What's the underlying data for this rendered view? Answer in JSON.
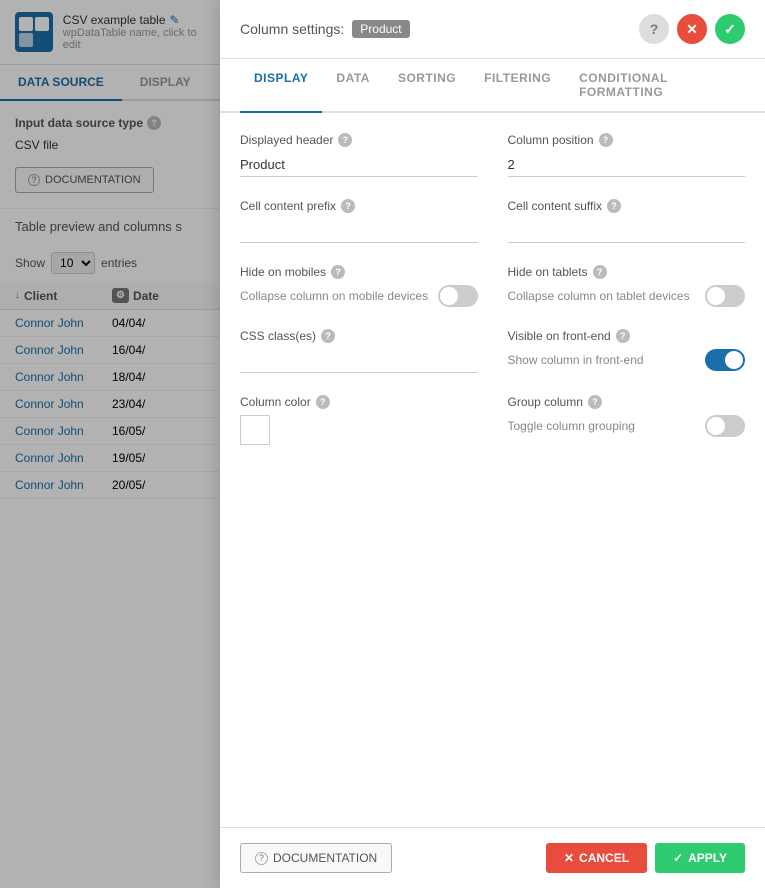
{
  "app": {
    "title": "CSV example table",
    "subtitle": "wpDataTable name, click to edit",
    "logo_alt": "wpDataTables logo"
  },
  "left_tabs": {
    "data_source": "DATA SOURCE",
    "display": "DISPLAY",
    "active": "DATA SOURCE"
  },
  "datasource": {
    "section_label": "Input data source type",
    "value": "CSV file",
    "doc_button": "DOCUMENTATION"
  },
  "table_preview": {
    "label": "Table preview and columns s",
    "show_label": "Show",
    "entries_value": "10",
    "entries_label": "entries",
    "columns": [
      {
        "name": "Client",
        "sortable": true
      },
      {
        "name": "Date",
        "sortable": false
      }
    ],
    "rows": [
      {
        "client": "Connor John",
        "date": "04/04/"
      },
      {
        "client": "Connor John",
        "date": "16/04/"
      },
      {
        "client": "Connor John",
        "date": "18/04/"
      },
      {
        "client": "Connor John",
        "date": "23/04/"
      },
      {
        "client": "Connor John",
        "date": "16/05/"
      },
      {
        "client": "Connor John",
        "date": "19/05/"
      },
      {
        "client": "Connor John",
        "date": "20/05/"
      }
    ]
  },
  "modal": {
    "title_prefix": "Column settings:",
    "column_name": "Product",
    "help_title": "Help",
    "close_title": "Close",
    "confirm_title": "Apply",
    "tabs": [
      {
        "id": "display",
        "label": "DISPLAY",
        "active": true
      },
      {
        "id": "data",
        "label": "DATA",
        "active": false
      },
      {
        "id": "sorting",
        "label": "SORTING",
        "active": false
      },
      {
        "id": "filtering",
        "label": "FILTERING",
        "active": false
      },
      {
        "id": "conditional",
        "label": "CONDITIONAL FORMATTING",
        "active": false
      }
    ],
    "fields": {
      "displayed_header": {
        "label": "Displayed header",
        "value": "Product",
        "placeholder": ""
      },
      "column_position": {
        "label": "Column position",
        "value": "2",
        "placeholder": ""
      },
      "cell_content_prefix": {
        "label": "Cell content prefix",
        "value": "",
        "placeholder": ""
      },
      "cell_content_suffix": {
        "label": "Cell content suffix",
        "value": "",
        "placeholder": ""
      },
      "hide_on_mobiles": {
        "label": "Hide on mobiles",
        "toggle_desc": "Collapse column on mobile devices",
        "enabled": false
      },
      "hide_on_tablets": {
        "label": "Hide on tablets",
        "toggle_desc": "Collapse column on tablet devices",
        "enabled": false
      },
      "css_classes": {
        "label": "CSS class(es)",
        "value": "",
        "placeholder": ""
      },
      "visible_on_frontend": {
        "label": "Visible on front-end",
        "toggle_desc": "Show column in front-end",
        "enabled": true
      },
      "column_color": {
        "label": "Column color",
        "value": ""
      },
      "group_column": {
        "label": "Group column",
        "toggle_desc": "Toggle column grouping",
        "enabled": false
      }
    },
    "doc_button": "DOCUMENTATION",
    "cancel_button": "CANCEL",
    "apply_button": "APPLY"
  }
}
